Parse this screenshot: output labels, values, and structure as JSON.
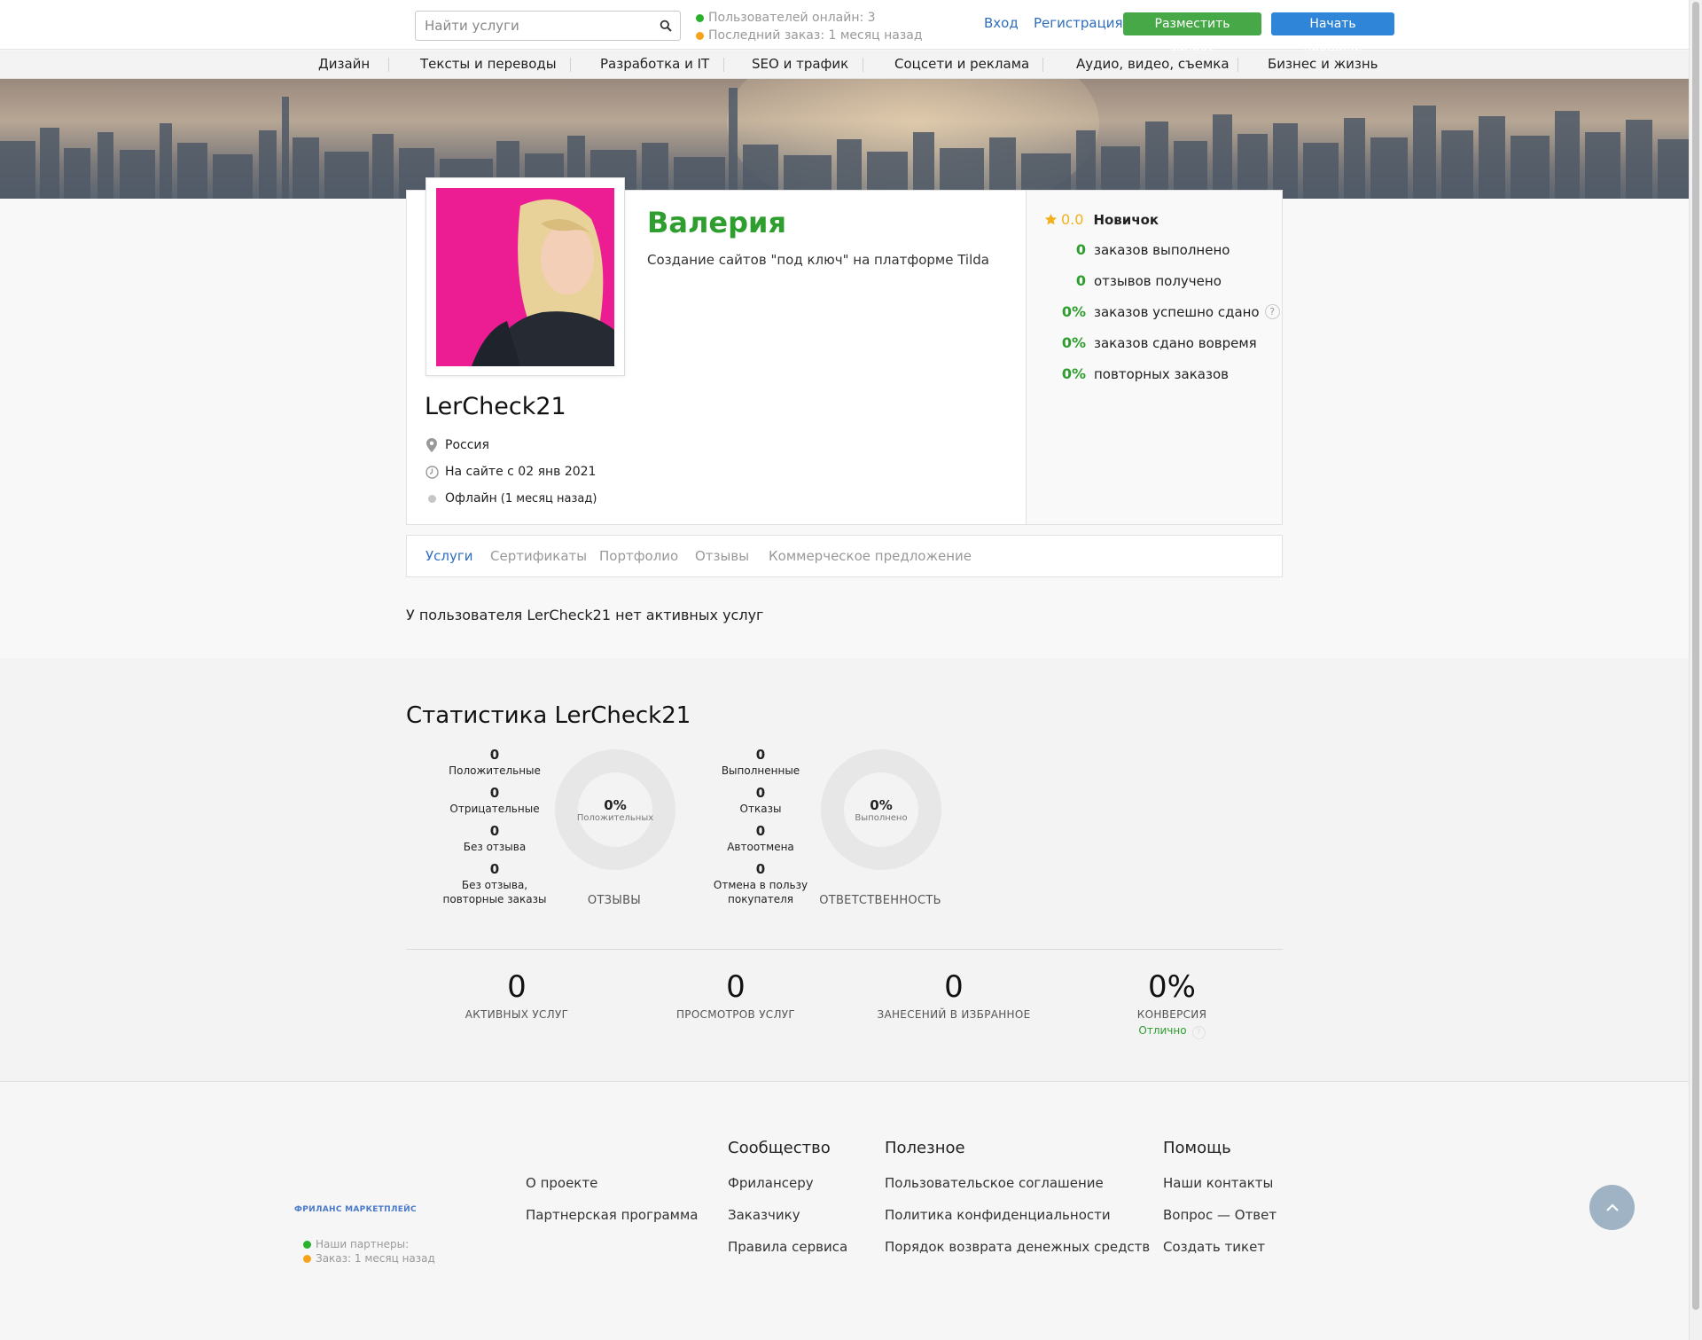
{
  "header": {
    "search_placeholder": "Найти услуги",
    "users_online": "Пользователей онлайн: 3",
    "last_order": "Последний заказ: 1 месяц назад",
    "login": "Вход",
    "register": "Регистрация",
    "post_request": "Разместить запрос",
    "start_selling": "Начать продажи"
  },
  "categories": [
    "Дизайн",
    "Тексты и переводы",
    "Разработка и IT",
    "SEO и трафик",
    "Соцсети и реклама",
    "Аудио, видео, съемка",
    "Бизнес и жизнь"
  ],
  "profile": {
    "display_name": "Валерия",
    "tagline": "Создание сайтов \"под ключ\" на платформе Tilda",
    "username": "LerCheck21",
    "country": "Россия",
    "member_since": "На сайте с 02 янв 2021",
    "status": "Офлайн",
    "status_detail": "(1 месяц назад)"
  },
  "rating": {
    "score": "0.0",
    "level": "Новичок"
  },
  "profile_stats": [
    {
      "value": "0",
      "label": "заказов выполнено"
    },
    {
      "value": "0",
      "label": "отзывов получено"
    },
    {
      "value": "0%",
      "label": "заказов успешно сдано"
    },
    {
      "value": "0%",
      "label": "заказов сдано вовремя"
    },
    {
      "value": "0%",
      "label": "повторных заказов"
    }
  ],
  "tabs": [
    "Услуги",
    "Сертификаты",
    "Портфолио",
    "Отзывы",
    "Коммерческое предложение"
  ],
  "no_services": "У пользователя LerCheck21 нет активных услуг",
  "statistics": {
    "title": "Статистика LerCheck21",
    "reviews": {
      "items": [
        {
          "value": "0",
          "label": "Положительные"
        },
        {
          "value": "0",
          "label": "Отрицательные"
        },
        {
          "value": "0",
          "label": "Без отзыва"
        },
        {
          "value": "0",
          "label": "Без отзыва, повторные заказы"
        }
      ],
      "donut_pct": "0%",
      "donut_sub": "Положительных",
      "caption": "ОТЗЫВЫ"
    },
    "responsibility": {
      "items": [
        {
          "value": "0",
          "label": "Выполненные"
        },
        {
          "value": "0",
          "label": "Отказы"
        },
        {
          "value": "0",
          "label": "Автоотмена"
        },
        {
          "value": "0",
          "label": "Отмена в пользу покупателя"
        }
      ],
      "donut_pct": "0%",
      "donut_sub": "Выполнено",
      "caption": "ОТВЕТСТВЕННОСТЬ"
    },
    "totals": [
      {
        "value": "0",
        "label": "АКТИВНЫХ УСЛУГ"
      },
      {
        "value": "0",
        "label": "ПРОСМОТРОВ  УСЛУГ"
      },
      {
        "value": "0",
        "label": "ЗАНЕСЕНИЙ  В ИЗБРАННОЕ"
      },
      {
        "value": "0%",
        "label": "КОНВЕРСИЯ",
        "extra": "Отлично"
      }
    ]
  },
  "footer": {
    "logo": "ФРИЛАНС МАРКЕТПЛЕЙС",
    "partners": "Наши партнеры:",
    "order": "Заказ: 1 месяц назад",
    "col0": {
      "links": [
        "О проекте",
        "Партнерская программа"
      ]
    },
    "col1": {
      "title": "Сообщество",
      "links": [
        "Фрилансеру",
        "Заказчику",
        "Правила сервиса"
      ]
    },
    "col2": {
      "title": "Полезное",
      "links": [
        "Пользовательское соглашение",
        "Политика конфиденциальности",
        "Порядок возврата денежных средств"
      ]
    },
    "col3": {
      "title": "Помощь",
      "links": [
        "Наши контакты",
        "Вопрос — Ответ",
        "Создать тикет"
      ]
    }
  },
  "colors": {
    "accent_green": "#2e9e2e",
    "link_blue": "#2d6ebd",
    "star": "#f2b01e",
    "avatar_bg": "#ec1c93"
  }
}
